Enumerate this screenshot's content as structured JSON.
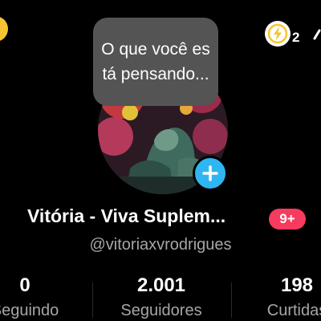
{
  "colors": {
    "background": "#000000",
    "thought_bubble": "#545454",
    "add_button": "#2fb6f2",
    "notification_badge": "#f63b5e",
    "secondary_text": "#a6a6a6",
    "bolt_accent": "#f7c531"
  },
  "header": {
    "left_icon": "yellow-circle-icon",
    "right_icon": "lightning-badge-icon",
    "right_badge_count": "2",
    "far_right_icon": "person-icon"
  },
  "thought_bubble": {
    "text": "O que você está pensando..."
  },
  "profile": {
    "avatar_icon": "avatar-image",
    "add_icon": "plus-icon",
    "display_name": "Vitória - Viva Suplem...",
    "notification_badge": "9+",
    "username": "@vitoriaxvrodrigues"
  },
  "stats": [
    {
      "value": "0",
      "label": "Seguindo"
    },
    {
      "value": "2.001",
      "label": "Seguidores"
    },
    {
      "value": "198",
      "label": "Curtidas"
    }
  ]
}
